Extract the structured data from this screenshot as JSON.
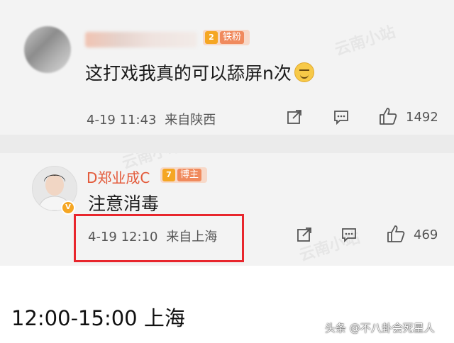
{
  "comments": [
    {
      "username": "",
      "level_tag": "铁粉",
      "level_number": "2",
      "text": "这打戏我真的可以舔屏n次",
      "emoji": "smirk-emoji",
      "date": "4-19",
      "time": "11:43",
      "location": "来自陕西",
      "likes": "1492"
    },
    {
      "username": "D郑业成C",
      "level_tag": "博主",
      "level_number": "7",
      "text": "注意消毒",
      "date": "4-19",
      "time": "12:10",
      "location": "来自上海",
      "likes": "469"
    }
  ],
  "highlight": {
    "color": "#e8262d"
  },
  "caption": "12:00-15:00 上海",
  "source": "头条 @不八卦会死星人",
  "colors": {
    "username_red": "#e35a3a",
    "badge_orange": "#f5a623",
    "background": "#f3f3f3"
  },
  "icons": [
    "share-icon",
    "comment-icon",
    "like-icon",
    "verified-icon",
    "crown-icon"
  ]
}
